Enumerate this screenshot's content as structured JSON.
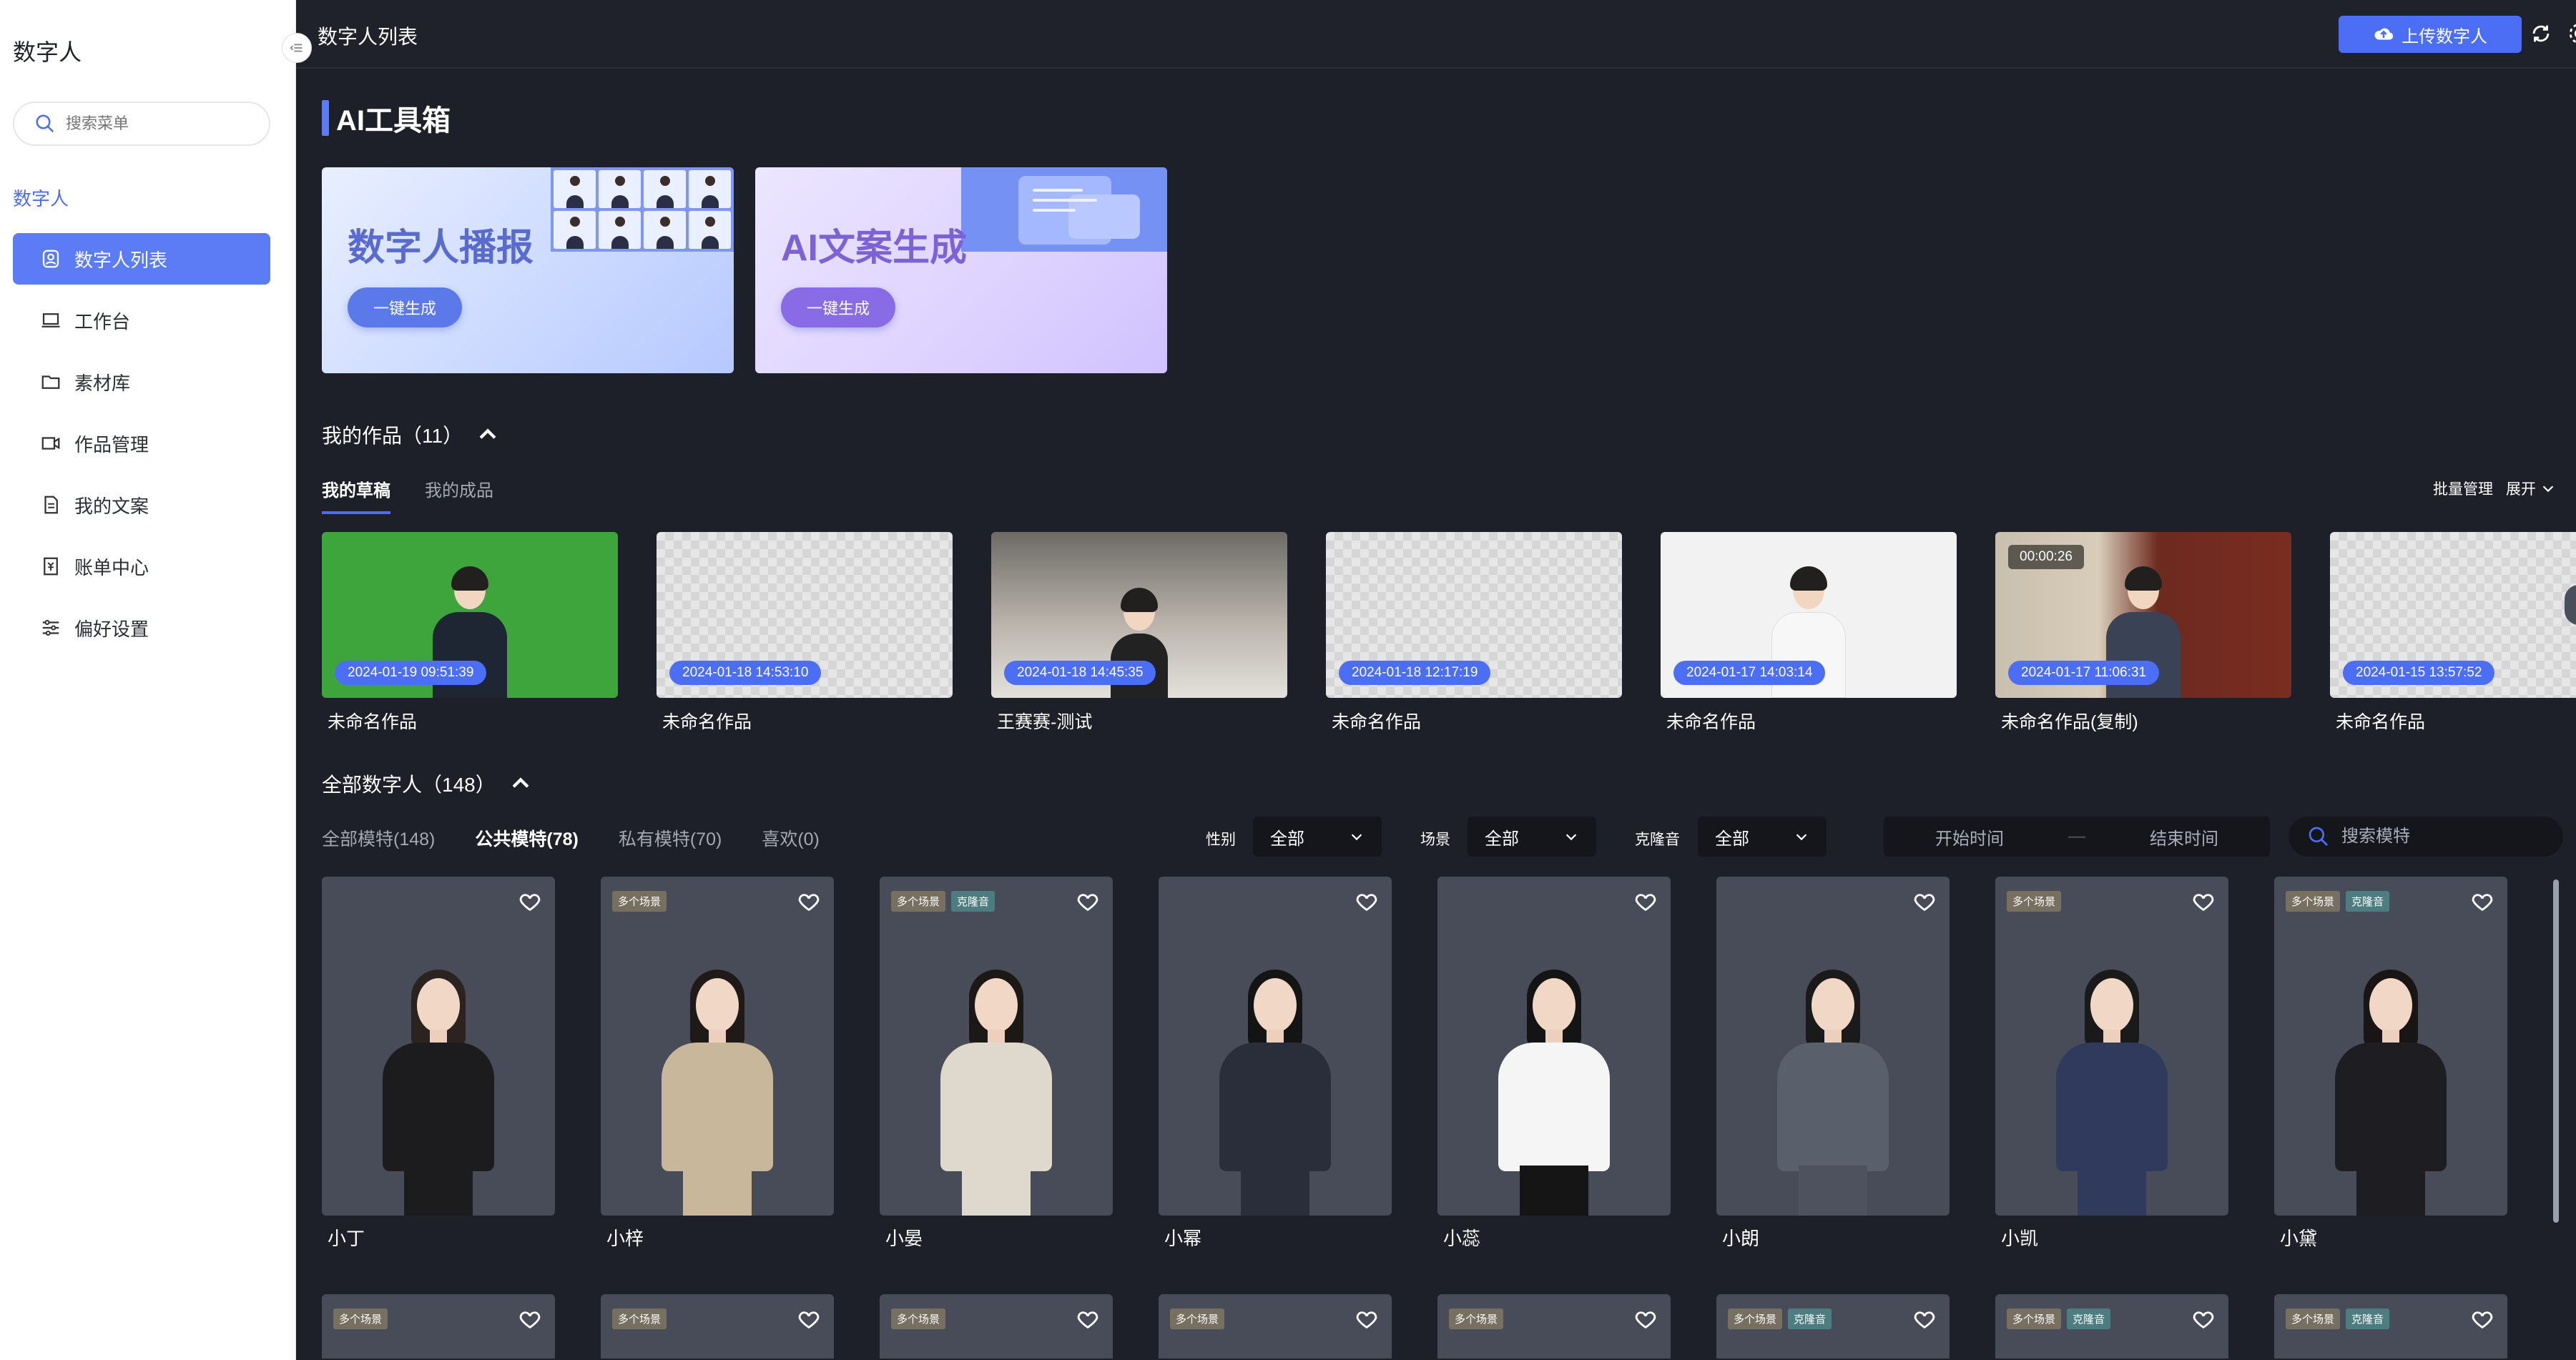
{
  "sidebar": {
    "app_title": "数字人",
    "search_placeholder": "搜索菜单",
    "section_label": "数字人",
    "items": [
      {
        "label": "数字人列表",
        "icon": "avatar-icon"
      },
      {
        "label": "工作台",
        "icon": "laptop-icon"
      },
      {
        "label": "素材库",
        "icon": "folder-icon"
      },
      {
        "label": "作品管理",
        "icon": "video-icon"
      },
      {
        "label": "我的文案",
        "icon": "document-icon"
      },
      {
        "label": "账单中心",
        "icon": "bill-icon"
      },
      {
        "label": "偏好设置",
        "icon": "sliders-icon"
      }
    ],
    "active_index": 0
  },
  "topbar": {
    "title": "数字人列表",
    "upload_label": "上传数字人"
  },
  "toolbox": {
    "title": "AI工具箱",
    "cards": [
      {
        "title": "数字人播报",
        "button": "一键生成"
      },
      {
        "title": "AI文案生成",
        "button": "一键生成"
      }
    ]
  },
  "works": {
    "title": "我的作品（11）",
    "tabs": [
      "我的草稿",
      "我的成品"
    ],
    "batch_label": "批量管理",
    "expand_label": "展开",
    "items": [
      {
        "name": "未命名作品",
        "date": "2024-01-19 09:51:39",
        "duration": ""
      },
      {
        "name": "未命名作品",
        "date": "2024-01-18 14:53:10",
        "duration": ""
      },
      {
        "name": "王赛赛-测试",
        "date": "2024-01-18 14:45:35",
        "duration": ""
      },
      {
        "name": "未命名作品",
        "date": "2024-01-18 12:17:19",
        "duration": ""
      },
      {
        "name": "未命名作品",
        "date": "2024-01-17 14:03:14",
        "duration": ""
      },
      {
        "name": "未命名作品(复制)",
        "date": "2024-01-17 11:06:31",
        "duration": "00:00:26"
      },
      {
        "name": "未命名作品",
        "date": "2024-01-15 13:57:52",
        "duration": ""
      }
    ]
  },
  "all_models": {
    "title": "全部数字人（148）",
    "tabs": [
      "全部模特(148)",
      "公共模特(78)",
      "私有模特(70)",
      "喜欢(0)"
    ],
    "active_tab": 1,
    "filters": [
      {
        "label": "性别",
        "value": "全部"
      },
      {
        "label": "场景",
        "value": "全部"
      },
      {
        "label": "克隆音",
        "value": "全部"
      }
    ],
    "start_time_placeholder": "开始时间",
    "end_time_placeholder": "结束时间",
    "search_placeholder": "搜索模特",
    "tag_multi": "多个场景",
    "tag_clone": "克隆音",
    "row1": [
      {
        "name": "小丁",
        "multi": false,
        "clone": false
      },
      {
        "name": "小梓",
        "multi": true,
        "clone": false
      },
      {
        "name": "小晏",
        "multi": true,
        "clone": true
      },
      {
        "name": "小幂",
        "multi": false,
        "clone": false
      },
      {
        "name": "小蕊",
        "multi": false,
        "clone": false
      },
      {
        "name": "小朗",
        "multi": false,
        "clone": false
      },
      {
        "name": "小凯",
        "multi": true,
        "clone": false
      },
      {
        "name": "小黛",
        "multi": true,
        "clone": true
      }
    ],
    "row2": [
      {
        "multi": true,
        "clone": false
      },
      {
        "multi": true,
        "clone": false
      },
      {
        "multi": true,
        "clone": false
      },
      {
        "multi": true,
        "clone": false
      },
      {
        "multi": true,
        "clone": false
      },
      {
        "multi": true,
        "clone": true
      },
      {
        "multi": true,
        "clone": true
      },
      {
        "multi": true,
        "clone": true
      }
    ]
  },
  "colors": {
    "accent": "#4c6ef5",
    "background": "#1d2028",
    "card": "#484c58"
  }
}
